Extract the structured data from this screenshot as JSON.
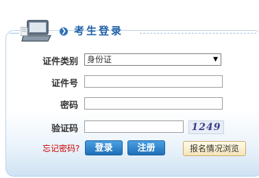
{
  "header": {
    "title": "考生登录",
    "bullet_glyph": "❯"
  },
  "form": {
    "id_type_label": "证件类别",
    "id_type_value": "身份证",
    "id_number_label": "证件号",
    "id_number_value": "",
    "password_label": "密码",
    "password_value": "",
    "captcha_label": "验证码",
    "captcha_value": "",
    "captcha_image_text": "1249"
  },
  "actions": {
    "forgot_label": "忘记密码?",
    "login_label": "登录",
    "register_label": "注册",
    "browse_label": "报名情况浏览"
  },
  "colors": {
    "accent": "#1f5fa7",
    "forgot": "#cc0000"
  }
}
